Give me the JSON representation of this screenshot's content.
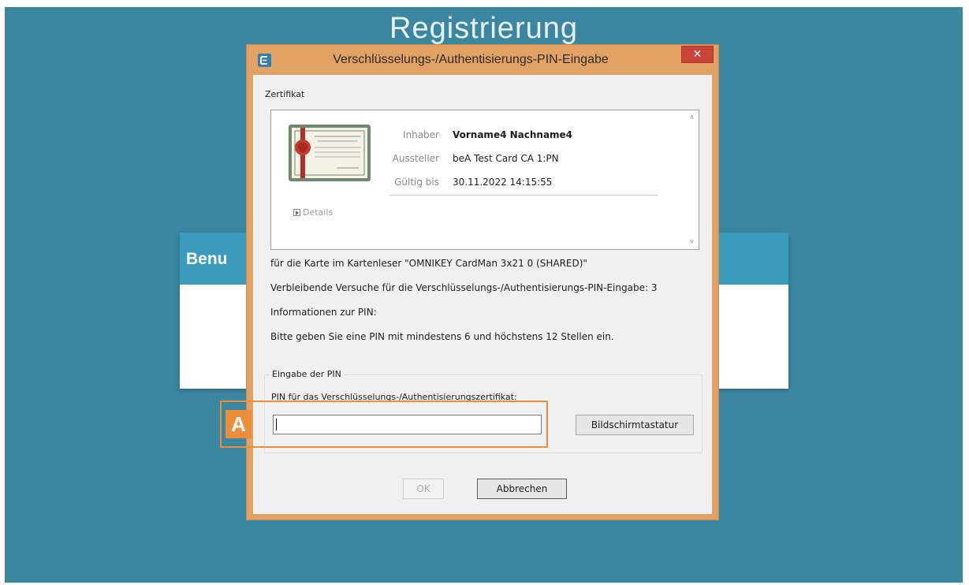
{
  "background": {
    "page_title": "Registrierung",
    "card_title": "Benu"
  },
  "dialog": {
    "title": "Verschlüsselungs-/Authentisierungs-PIN-Eingabe",
    "close_symbol": "✕",
    "certificate_group_label": "Zertifikat",
    "certificate": {
      "owner_label": "Inhaber",
      "owner_value": "Vorname4 Nachname4",
      "issuer_label": "Aussteller",
      "issuer_value": "beA Test Card CA 1:PN",
      "valid_label": "Gültig bis",
      "valid_value": "30.11.2022 14:15:55",
      "details_label": "Details"
    },
    "card_reader_text": "für die Karte im Kartenleser \"OMNIKEY CardMan 3x21 0 (SHARED)\"",
    "remaining_attempts_text": "Verbleibende Versuche für die Verschlüsselungs-/Authentisierungs-PIN-Eingabe: 3",
    "pin_info_title": "Informationen zur PIN:",
    "pin_info_text": "Bitte geben Sie eine PIN mit mindestens 6 und höchstens 12 Stellen ein.",
    "pin_group_label": "Eingabe der PIN",
    "pin_field_label": "PIN für das Verschlüsselungs-/Authentisierungszertifikat:",
    "pin_value": "",
    "keyboard_button": "Bildschirmtastatur",
    "ok_button": "OK",
    "cancel_button": "Abbrechen"
  },
  "annotation": {
    "marker_label": "A",
    "color": "#ec8d3a"
  },
  "colors": {
    "desktop": "#3b87a1",
    "dialog_frame": "#e2a264",
    "close_button": "#c9453a"
  }
}
